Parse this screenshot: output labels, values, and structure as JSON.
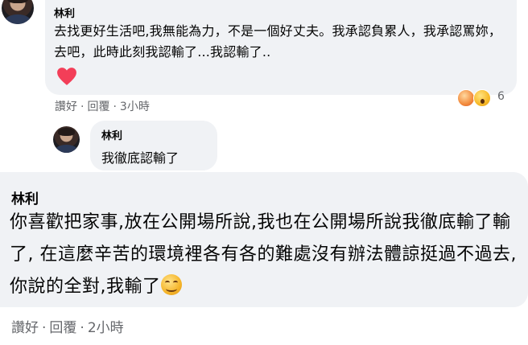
{
  "comment1": {
    "author": "林利",
    "text": "去找更好生活吧,我無能為力，不是一個好丈夫。我承認負累人，我承認罵妳，去吧，此時此刻我認輸了...我認輸了..",
    "like_label": "讚好",
    "sep": "·",
    "reply_label": "回覆",
    "time": "3小時",
    "reaction_count": "6",
    "reaction_icons": [
      "heart-emoji-icon",
      "wow-emoji-icon"
    ]
  },
  "reply1": {
    "author": "林利",
    "text": "我徹底認輸了"
  },
  "comment2": {
    "author": "林利",
    "text": "你喜歡把家事,放在公開場所說,我也在公開場所說我徹底輸了輸了, 在這麼辛苦的環境裡各有各的難處沒有辦法體諒挺過不過去,你說的全對,我輸了",
    "like_label": "讚好",
    "sep": "·",
    "reply_label": "回覆",
    "time": "2小時",
    "emoji": "smiling-face-icon"
  },
  "colors": {
    "bubble": "#f0f2f5",
    "meta_text": "#65676b",
    "heart": "#f33e58"
  }
}
